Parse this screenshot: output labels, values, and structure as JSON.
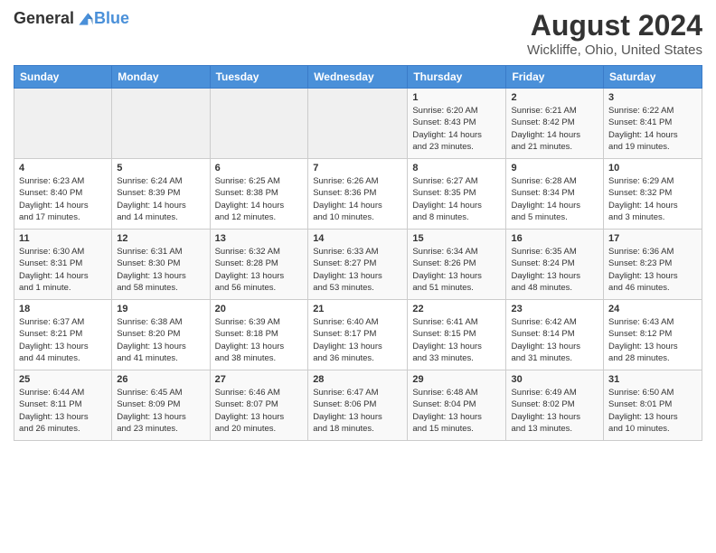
{
  "header": {
    "logo_general": "General",
    "logo_blue": "Blue",
    "main_title": "August 2024",
    "subtitle": "Wickliffe, Ohio, United States"
  },
  "calendar": {
    "days_of_week": [
      "Sunday",
      "Monday",
      "Tuesday",
      "Wednesday",
      "Thursday",
      "Friday",
      "Saturday"
    ],
    "weeks": [
      [
        {
          "day": "",
          "info": ""
        },
        {
          "day": "",
          "info": ""
        },
        {
          "day": "",
          "info": ""
        },
        {
          "day": "",
          "info": ""
        },
        {
          "day": "1",
          "info": "Sunrise: 6:20 AM\nSunset: 8:43 PM\nDaylight: 14 hours\nand 23 minutes."
        },
        {
          "day": "2",
          "info": "Sunrise: 6:21 AM\nSunset: 8:42 PM\nDaylight: 14 hours\nand 21 minutes."
        },
        {
          "day": "3",
          "info": "Sunrise: 6:22 AM\nSunset: 8:41 PM\nDaylight: 14 hours\nand 19 minutes."
        }
      ],
      [
        {
          "day": "4",
          "info": "Sunrise: 6:23 AM\nSunset: 8:40 PM\nDaylight: 14 hours\nand 17 minutes."
        },
        {
          "day": "5",
          "info": "Sunrise: 6:24 AM\nSunset: 8:39 PM\nDaylight: 14 hours\nand 14 minutes."
        },
        {
          "day": "6",
          "info": "Sunrise: 6:25 AM\nSunset: 8:38 PM\nDaylight: 14 hours\nand 12 minutes."
        },
        {
          "day": "7",
          "info": "Sunrise: 6:26 AM\nSunset: 8:36 PM\nDaylight: 14 hours\nand 10 minutes."
        },
        {
          "day": "8",
          "info": "Sunrise: 6:27 AM\nSunset: 8:35 PM\nDaylight: 14 hours\nand 8 minutes."
        },
        {
          "day": "9",
          "info": "Sunrise: 6:28 AM\nSunset: 8:34 PM\nDaylight: 14 hours\nand 5 minutes."
        },
        {
          "day": "10",
          "info": "Sunrise: 6:29 AM\nSunset: 8:32 PM\nDaylight: 14 hours\nand 3 minutes."
        }
      ],
      [
        {
          "day": "11",
          "info": "Sunrise: 6:30 AM\nSunset: 8:31 PM\nDaylight: 14 hours\nand 1 minute."
        },
        {
          "day": "12",
          "info": "Sunrise: 6:31 AM\nSunset: 8:30 PM\nDaylight: 13 hours\nand 58 minutes."
        },
        {
          "day": "13",
          "info": "Sunrise: 6:32 AM\nSunset: 8:28 PM\nDaylight: 13 hours\nand 56 minutes."
        },
        {
          "day": "14",
          "info": "Sunrise: 6:33 AM\nSunset: 8:27 PM\nDaylight: 13 hours\nand 53 minutes."
        },
        {
          "day": "15",
          "info": "Sunrise: 6:34 AM\nSunset: 8:26 PM\nDaylight: 13 hours\nand 51 minutes."
        },
        {
          "day": "16",
          "info": "Sunrise: 6:35 AM\nSunset: 8:24 PM\nDaylight: 13 hours\nand 48 minutes."
        },
        {
          "day": "17",
          "info": "Sunrise: 6:36 AM\nSunset: 8:23 PM\nDaylight: 13 hours\nand 46 minutes."
        }
      ],
      [
        {
          "day": "18",
          "info": "Sunrise: 6:37 AM\nSunset: 8:21 PM\nDaylight: 13 hours\nand 44 minutes."
        },
        {
          "day": "19",
          "info": "Sunrise: 6:38 AM\nSunset: 8:20 PM\nDaylight: 13 hours\nand 41 minutes."
        },
        {
          "day": "20",
          "info": "Sunrise: 6:39 AM\nSunset: 8:18 PM\nDaylight: 13 hours\nand 38 minutes."
        },
        {
          "day": "21",
          "info": "Sunrise: 6:40 AM\nSunset: 8:17 PM\nDaylight: 13 hours\nand 36 minutes."
        },
        {
          "day": "22",
          "info": "Sunrise: 6:41 AM\nSunset: 8:15 PM\nDaylight: 13 hours\nand 33 minutes."
        },
        {
          "day": "23",
          "info": "Sunrise: 6:42 AM\nSunset: 8:14 PM\nDaylight: 13 hours\nand 31 minutes."
        },
        {
          "day": "24",
          "info": "Sunrise: 6:43 AM\nSunset: 8:12 PM\nDaylight: 13 hours\nand 28 minutes."
        }
      ],
      [
        {
          "day": "25",
          "info": "Sunrise: 6:44 AM\nSunset: 8:11 PM\nDaylight: 13 hours\nand 26 minutes."
        },
        {
          "day": "26",
          "info": "Sunrise: 6:45 AM\nSunset: 8:09 PM\nDaylight: 13 hours\nand 23 minutes."
        },
        {
          "day": "27",
          "info": "Sunrise: 6:46 AM\nSunset: 8:07 PM\nDaylight: 13 hours\nand 20 minutes."
        },
        {
          "day": "28",
          "info": "Sunrise: 6:47 AM\nSunset: 8:06 PM\nDaylight: 13 hours\nand 18 minutes."
        },
        {
          "day": "29",
          "info": "Sunrise: 6:48 AM\nSunset: 8:04 PM\nDaylight: 13 hours\nand 15 minutes."
        },
        {
          "day": "30",
          "info": "Sunrise: 6:49 AM\nSunset: 8:02 PM\nDaylight: 13 hours\nand 13 minutes."
        },
        {
          "day": "31",
          "info": "Sunrise: 6:50 AM\nSunset: 8:01 PM\nDaylight: 13 hours\nand 10 minutes."
        }
      ]
    ]
  }
}
